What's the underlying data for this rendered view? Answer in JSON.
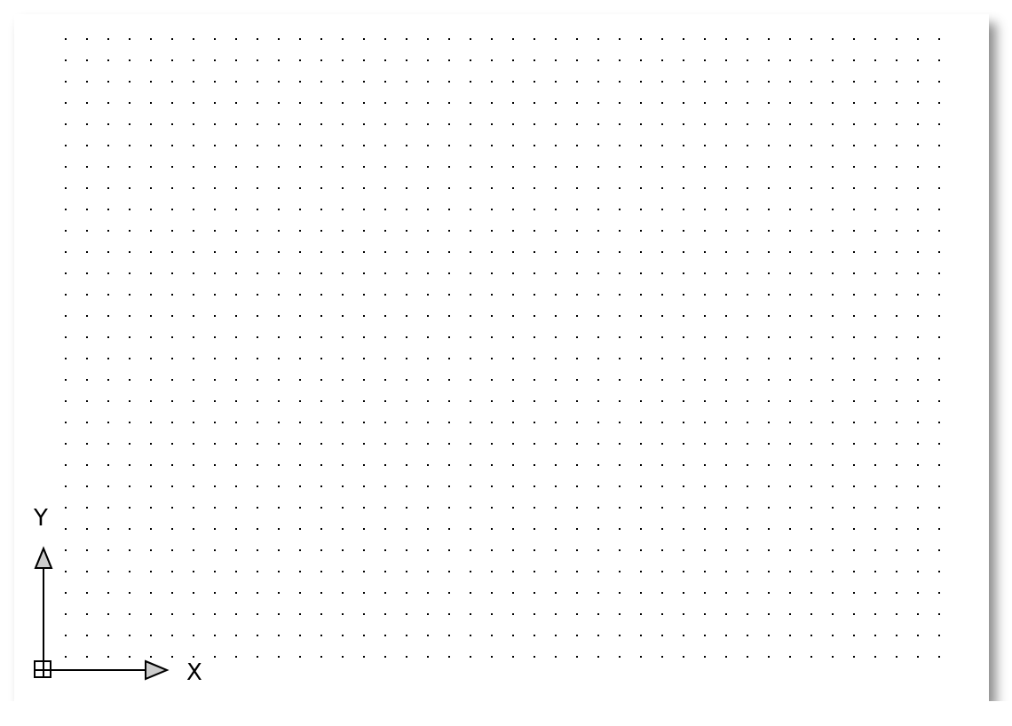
{
  "canvas": {
    "grid_visible": true,
    "ucs_icon": {
      "x_label": "X",
      "y_label": "Y"
    }
  }
}
